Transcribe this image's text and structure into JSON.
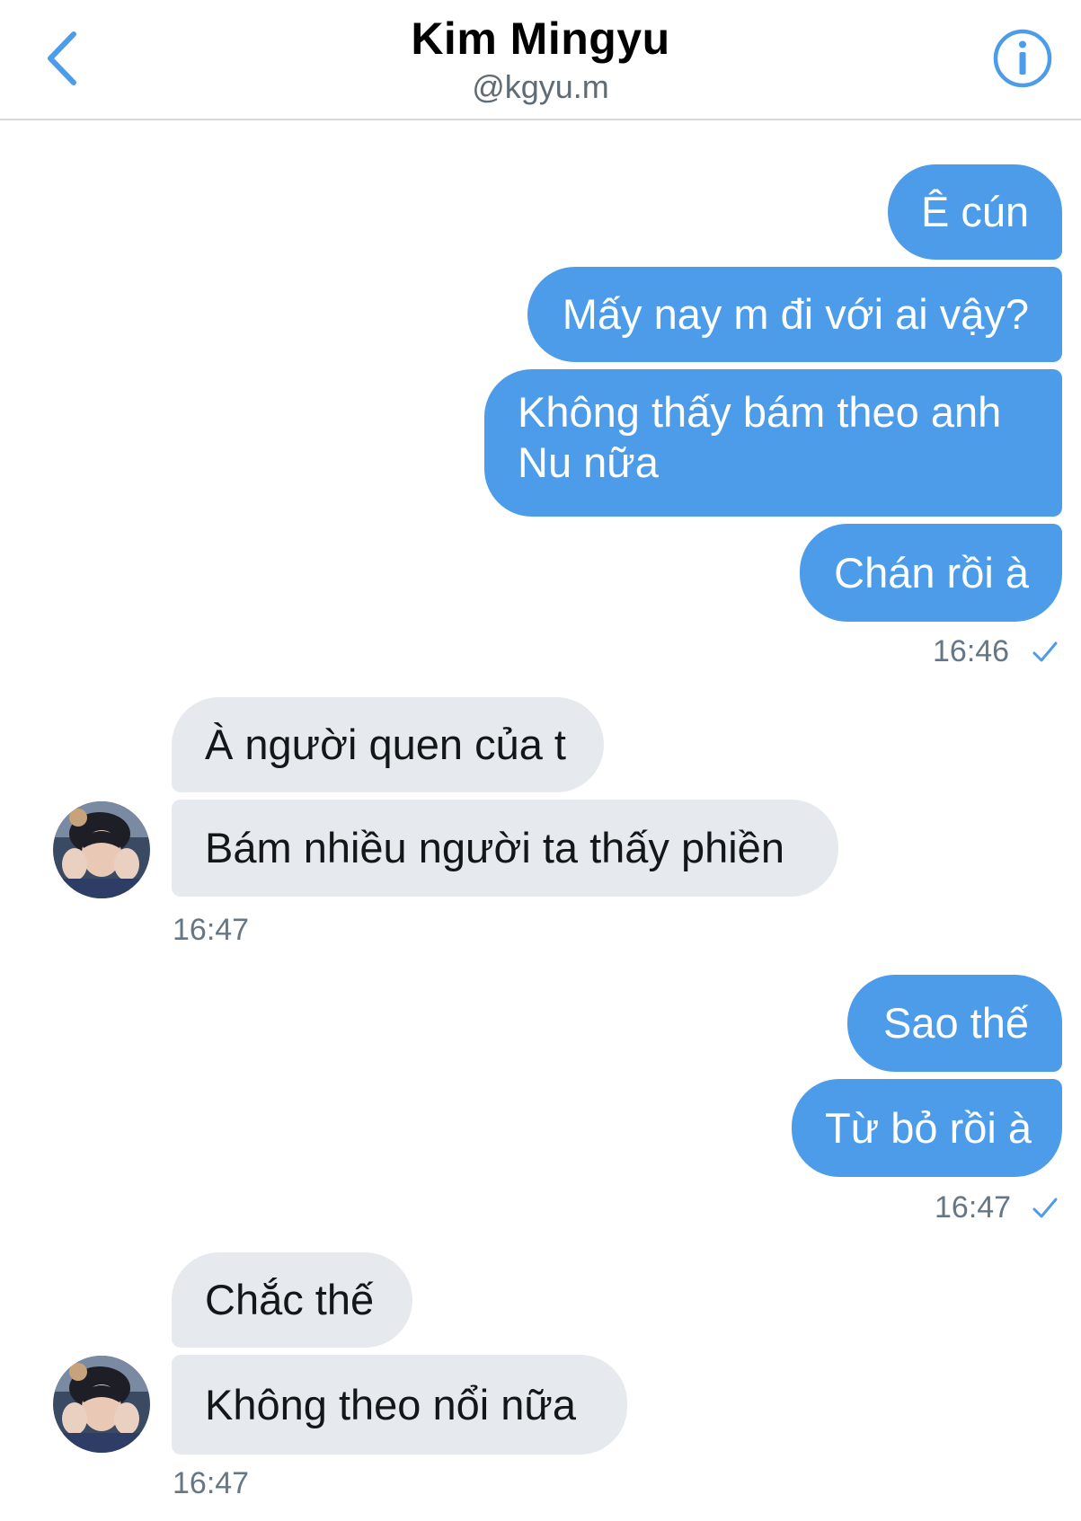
{
  "header": {
    "title": "Kim Mingyu",
    "handle": "@kgyu.m",
    "back_icon": "chevron-left-icon",
    "info_icon": "info-circle-icon"
  },
  "colors": {
    "accent": "#4d9cea",
    "incoming_bubble": "#e6e9ed",
    "timestamp": "#657786"
  },
  "messages": [
    {
      "dir": "out",
      "text": "Ê cún"
    },
    {
      "dir": "out",
      "text": "Mấy nay m đi với ai vậy?"
    },
    {
      "dir": "out",
      "text": "Không thấy bám theo anh Nu nữa"
    },
    {
      "dir": "out",
      "text": "Chán rồi à"
    },
    {
      "dir": "in",
      "text": "À người quen của t"
    },
    {
      "dir": "in",
      "text": "Bám nhiều người ta thấy phiền"
    },
    {
      "dir": "out",
      "text": "Sao thế"
    },
    {
      "dir": "out",
      "text": "Từ bỏ rồi à"
    },
    {
      "dir": "in",
      "text": "Chắc thế"
    },
    {
      "dir": "in",
      "text": "Không theo nổi nữa"
    }
  ],
  "timestamps": [
    "16:46",
    "16:47",
    "16:47",
    "16:47"
  ],
  "read_icon": "checkmark-icon"
}
